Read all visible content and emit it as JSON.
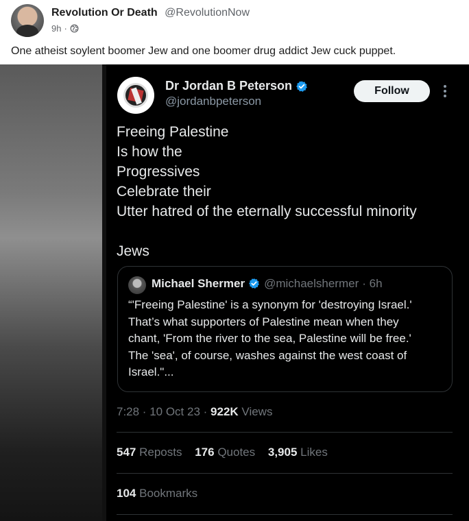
{
  "post": {
    "author_name": "Revolution Or Death",
    "author_handle": "@RevolutionNow",
    "time": "9h",
    "separator": "·",
    "text": "One atheist soylent boomer Jew and one boomer drug addict Jew cuck puppet."
  },
  "embedded_tweet": {
    "name": "Dr Jordan B Peterson",
    "handle": "@jordanbpeterson",
    "follow_label": "Follow",
    "body_lines": [
      "Freeing Palestine",
      "Is how the",
      "Progressives",
      "Celebrate their",
      "Utter hatred of the eternally successful minority",
      "",
      "Jews"
    ],
    "quote": {
      "name": "Michael Shermer",
      "handle": "@michaelshermer",
      "time": "· 6h",
      "text_lines": [
        "“'Freeing Palestine' is a synonym for 'destroying Israel.'",
        "That’s what supporters of Palestine mean when they",
        "chant, 'From the river to the sea, Palestine will be free.'",
        "The 'sea', of course, washes against the west coast of",
        "Israel.\"..."
      ]
    },
    "timestamp": "7:28 · 10 Oct 23 ·",
    "views_count": "922K",
    "views_label": "Views",
    "stats": {
      "reposts_count": "547",
      "reposts_label": "Reposts",
      "quotes_count": "176",
      "quotes_label": "Quotes",
      "likes_count": "3,905",
      "likes_label": "Likes",
      "bookmarks_count": "104",
      "bookmarks_label": "Bookmarks"
    }
  },
  "colors": {
    "verified_blue": "#1d9bf0",
    "tweet_bg": "#000000",
    "tweet_text": "#e7e9ea",
    "tweet_muted": "#71767b"
  },
  "icons": [
    "globe-icon",
    "verified-icon",
    "more-options-icon"
  ]
}
